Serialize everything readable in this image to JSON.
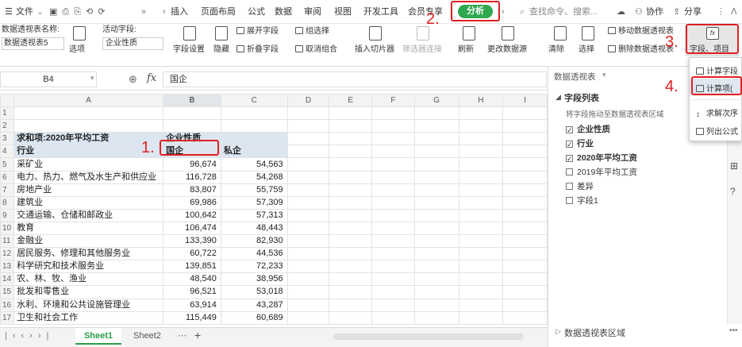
{
  "menu": {
    "file": "文件",
    "tabs": [
      "插入",
      "页面布局",
      "公式",
      "数据",
      "审阅",
      "视图",
      "开发工具",
      "会员专享"
    ],
    "active_tab": "分析",
    "search": "查找命令、搜索...",
    "collab": "协作",
    "share": "分享"
  },
  "ribbon": {
    "pivot_name_label": "数据透视表名称:",
    "pivot_name": "数据透视表5",
    "options": "选项",
    "active_field_label": "活动字段:",
    "active_field": "企业性质",
    "field_settings": "字段设置",
    "hide": "隐藏",
    "expand": "展开字段",
    "collapse": "折叠字段",
    "group": "组选择",
    "ungroup": "取消组合",
    "slicer": "插入切片器",
    "filter_conn": "筛选器连接",
    "refresh": "刷新",
    "change_source": "更改数据源",
    "clear": "清除",
    "select": "选择",
    "move_pivot": "移动数据透视表",
    "delete_pivot": "删除数据透视表",
    "fields_items": "字段、项目"
  },
  "formula": {
    "cell_ref": "B4",
    "fx": "fx",
    "value": "国企"
  },
  "columns": [
    "A",
    "B",
    "C",
    "D",
    "E",
    "F",
    "G",
    "H",
    "I"
  ],
  "rows": [
    {
      "n": "1",
      "a": "",
      "b": "",
      "c": ""
    },
    {
      "n": "2",
      "a": "",
      "b": "",
      "c": ""
    },
    {
      "n": "3",
      "a": "求和项:2020年平均工资",
      "b": "企业性质",
      "c": ""
    },
    {
      "n": "4",
      "a": "行业",
      "b": "国企",
      "c": "私企"
    },
    {
      "n": "5",
      "a": "采矿业",
      "b": "96,674",
      "c": "54,563"
    },
    {
      "n": "6",
      "a": "电力、热力、燃气及水生产和供应业",
      "b": "116,728",
      "c": "54,268"
    },
    {
      "n": "7",
      "a": "房地产业",
      "b": "83,807",
      "c": "55,759"
    },
    {
      "n": "8",
      "a": "建筑业",
      "b": "69,986",
      "c": "57,309"
    },
    {
      "n": "9",
      "a": "交通运输、仓储和邮政业",
      "b": "100,642",
      "c": "57,313"
    },
    {
      "n": "10",
      "a": "教育",
      "b": "106,474",
      "c": "48,443"
    },
    {
      "n": "11",
      "a": "金融业",
      "b": "133,390",
      "c": "82,930"
    },
    {
      "n": "12",
      "a": "居民服务、修理和其他服务业",
      "b": "60,722",
      "c": "44,536"
    },
    {
      "n": "13",
      "a": "科学研究和技术服务业",
      "b": "139,851",
      "c": "72,233"
    },
    {
      "n": "14",
      "a": "农、林、牧、渔业",
      "b": "48,540",
      "c": "38,956"
    },
    {
      "n": "15",
      "a": "批发和零售业",
      "b": "96,521",
      "c": "53,018"
    },
    {
      "n": "16",
      "a": "水利、环境和公共设施管理业",
      "b": "63,914",
      "c": "43,287"
    },
    {
      "n": "17",
      "a": "卫生和社会工作",
      "b": "115,449",
      "c": "60,689"
    }
  ],
  "sheets": [
    "Sheet1",
    "Sheet2"
  ],
  "panel": {
    "title": "数据透视表",
    "field_list": "字段列表",
    "hint": "将字段拖动至数据透视表区域",
    "fields": [
      {
        "label": "企业性质",
        "checked": "✓"
      },
      {
        "label": "行业",
        "checked": "✓"
      },
      {
        "label": "2020年平均工资",
        "checked": "✓"
      },
      {
        "label": "2019年平均工资",
        "checked": ""
      },
      {
        "label": "差异",
        "checked": ""
      },
      {
        "label": "字段1",
        "checked": ""
      }
    ],
    "areas": "数据透视表区域"
  },
  "dropdown": {
    "items": [
      "计算字段",
      "计算项(",
      "求解次序",
      "列出公式"
    ]
  },
  "steps": [
    "1.",
    "2.",
    "3.",
    "4."
  ]
}
